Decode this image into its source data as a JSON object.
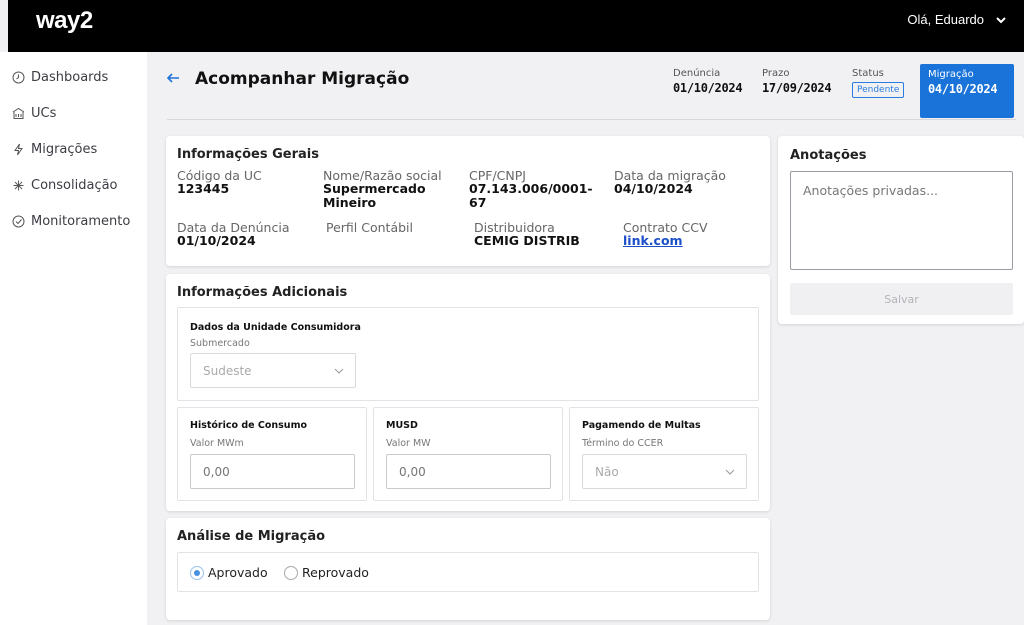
{
  "header": {
    "logo": "way2",
    "greeting": "Olá, Eduardo"
  },
  "sidebar": {
    "items": [
      {
        "label": "Dashboards",
        "icon": "clock-icon"
      },
      {
        "label": "UCs",
        "icon": "building-icon"
      },
      {
        "label": "Migrações",
        "icon": "bolt-icon"
      },
      {
        "label": "Consolidação",
        "icon": "sparkle-icon"
      },
      {
        "label": "Monitoramento",
        "icon": "check-circle-icon"
      }
    ]
  },
  "page": {
    "title": "Acompanhar Migração",
    "meta": {
      "denuncia_label": "Denúncia",
      "denuncia_value": "01/10/2024",
      "prazo_label": "Prazo",
      "prazo_value": "17/09/2024",
      "status_label": "Status",
      "status_value": "Pendente",
      "migracao_label": "Migração",
      "migracao_value": "04/10/2024"
    }
  },
  "info_gerais": {
    "title": "Informações Gerais",
    "codigo_uc_label": "Código da UC",
    "codigo_uc_value": "123445",
    "nome_label": "Nome/Razão social",
    "nome_value_line1": "Supermercado",
    "nome_value_line2": "Mineiro",
    "cpf_label": "CPF/CNPJ",
    "cpf_value_line1": "07.143.006/0001-",
    "cpf_value_line2": "67",
    "data_migracao_label": "Data da migração",
    "data_migracao_value": "04/10/2024",
    "data_denuncia_label": "Data da Denúncia",
    "data_denuncia_value": "01/10/2024",
    "perfil_label": "Perfil Contábil",
    "distribuidora_label": "Distribuidora",
    "distribuidora_value": "CEMIG DISTRIB",
    "contrato_label": "Contrato CCV",
    "contrato_value": "link.com"
  },
  "info_adicionais": {
    "title": "Informações Adicionais",
    "dados_uc_title": "Dados da Unidade Consumidora",
    "submercado_label": "Submercado",
    "submercado_value": "Sudeste",
    "historico_title": "Histórico de Consumo",
    "historico_label": "Valor MWm",
    "historico_placeholder": "0,00",
    "musd_title": "MUSD",
    "musd_label": "Valor MW",
    "musd_placeholder": "0,00",
    "multas_title": "Pagamendo de Multas",
    "multas_label": "Término do CCER",
    "multas_value": "Não"
  },
  "analise": {
    "title": "Análise de Migração",
    "aprovado_label": "Aprovado",
    "reprovado_label": "Reprovado",
    "selected": "Aprovado"
  },
  "anotacoes": {
    "title": "Anotações",
    "placeholder": "Anotações privadas...",
    "save_label": "Salvar"
  },
  "colors": {
    "accent": "#1a73d9",
    "topbar": "#000000",
    "background": "#f1f1f3"
  }
}
